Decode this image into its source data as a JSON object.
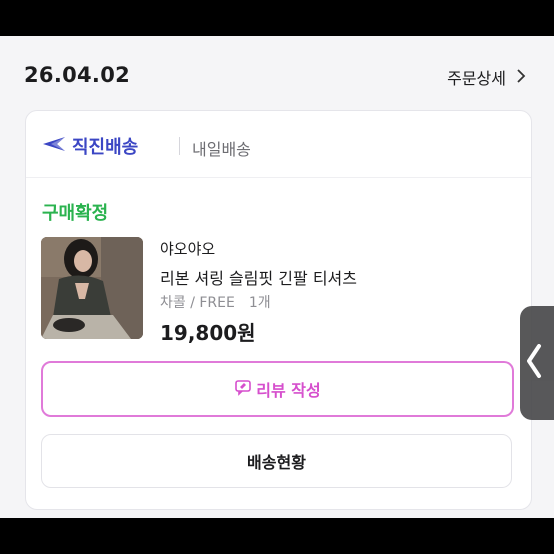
{
  "order": {
    "date": "26.04.02",
    "detail_label": "주문상세",
    "detail_chevron": "›"
  },
  "shipping": {
    "direct_label": "직진배송",
    "direct_icon": "arrow-badge-icon",
    "nextday_label": "내일배송",
    "brand_color": "#3b46c4"
  },
  "item": {
    "status": "구매확정",
    "status_color": "#2bb34f",
    "seller": "야오야오",
    "name": "리본 셔링 슬림핏 긴팔 티셔츠",
    "option": "차콜 / FREE",
    "quantity": "1개",
    "price": "19,800원"
  },
  "actions": {
    "review_label": "리뷰 작성",
    "review_icon": "chat-pen-icon",
    "review_color": "#d64fcd",
    "track_label": "배송현황"
  },
  "overlay": {
    "handle_icon": "chevron-left-icon"
  }
}
